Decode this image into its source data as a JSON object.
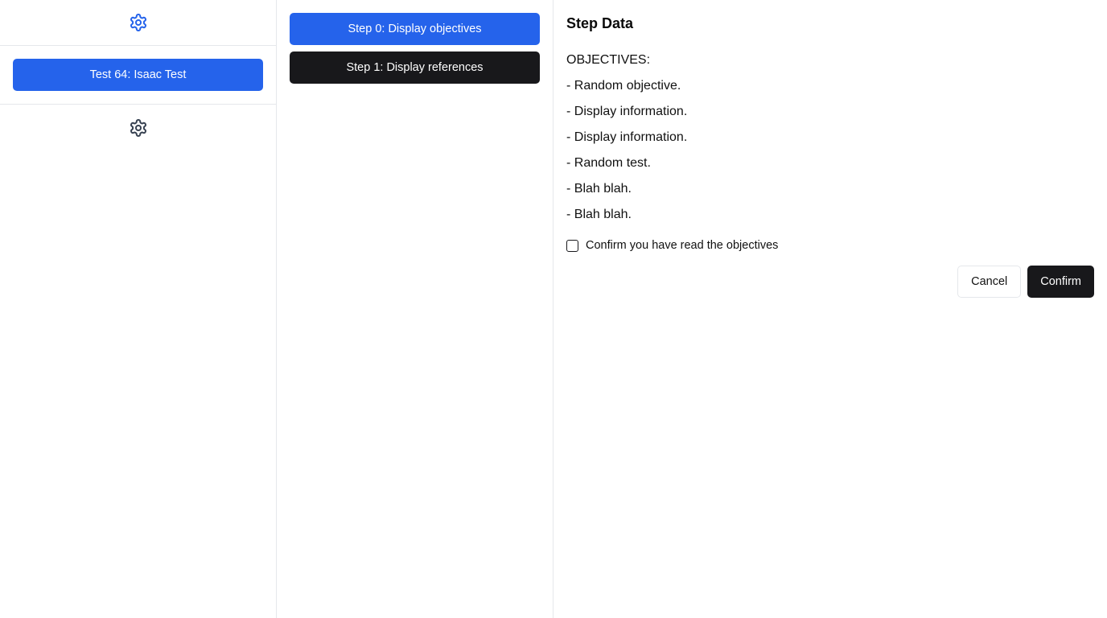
{
  "sidebar": {
    "top_icon": "gear-icon",
    "top_icon_color": "#2563eb",
    "test_button_label": "Test 64: Isaac Test",
    "bottom_icon": "gear-icon",
    "bottom_icon_color": "#374151"
  },
  "steps": [
    {
      "label": "Step 0: Display objectives",
      "active": true
    },
    {
      "label": "Step 1: Display references",
      "active": false
    }
  ],
  "main": {
    "title": "Step Data",
    "objectives_header": "OBJECTIVES:",
    "objectives": [
      "- Random objective.",
      "- Display information.",
      "- Display information.",
      "- Random test.",
      "- Blah blah.",
      "- Blah blah."
    ],
    "confirm_label": "Confirm you have read the objectives",
    "confirm_checked": false,
    "cancel_label": "Cancel",
    "confirm_button_label": "Confirm"
  },
  "colors": {
    "accent": "#2563eb",
    "dark": "#18181b",
    "border": "#e5e7eb"
  }
}
